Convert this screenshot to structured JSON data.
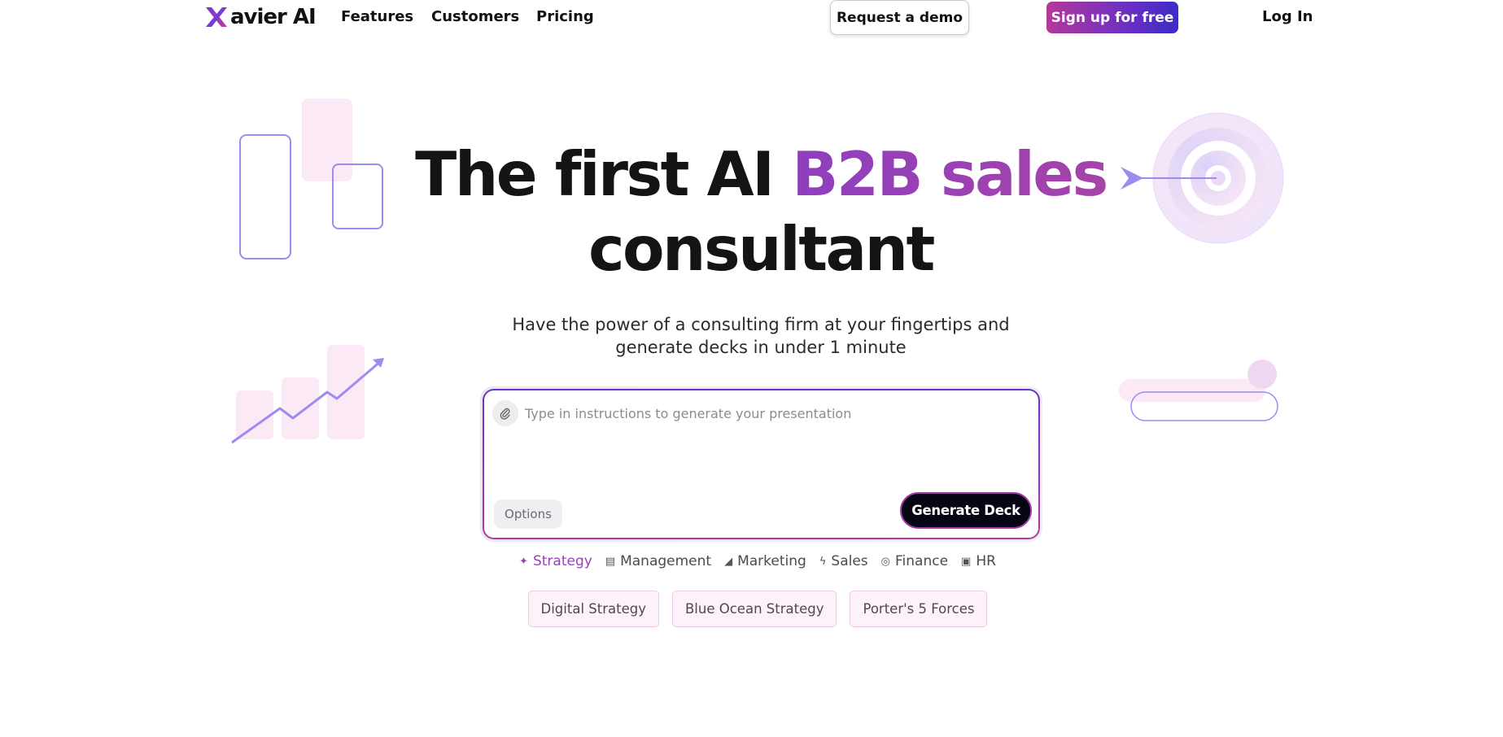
{
  "nav": {
    "logo_letter": "X",
    "logo_text": "avier AI",
    "links": [
      "Features",
      "Customers",
      "Pricing"
    ],
    "request_demo": "Request a demo",
    "signup": "Sign up for free",
    "login": "Log In"
  },
  "hero": {
    "title_part1": "The first AI ",
    "title_accent": "B2B sales",
    "title_part2": "consultant",
    "subtitle": "Have the power of a consulting firm at your fingertips and generate decks in under 1 minute"
  },
  "prompt": {
    "placeholder": "Type in instructions to generate your presentation",
    "options_label": "Options",
    "generate_label": "Generate Deck"
  },
  "categories": [
    {
      "label": "Strategy",
      "icon": "puzzle-icon",
      "active": true
    },
    {
      "label": "Management",
      "icon": "document-icon",
      "active": false
    },
    {
      "label": "Marketing",
      "icon": "megaphone-icon",
      "active": false
    },
    {
      "label": "Sales",
      "icon": "lightning-icon",
      "active": false
    },
    {
      "label": "Finance",
      "icon": "coins-icon",
      "active": false
    },
    {
      "label": "HR",
      "icon": "people-icon",
      "active": false
    }
  ],
  "templates": [
    "Digital Strategy",
    "Blue Ocean Strategy",
    "Porter's 5 Forces"
  ],
  "colors": {
    "accent_purple": "#9a3fbf",
    "signup_gradient_start": "#b4389a",
    "signup_gradient_end": "#3c2cc6",
    "generate_bg": "#050514",
    "chip_bg": "#fdf1fa",
    "decor_lavender": "#9d8cf0",
    "decor_pink": "#fbe9f6"
  }
}
